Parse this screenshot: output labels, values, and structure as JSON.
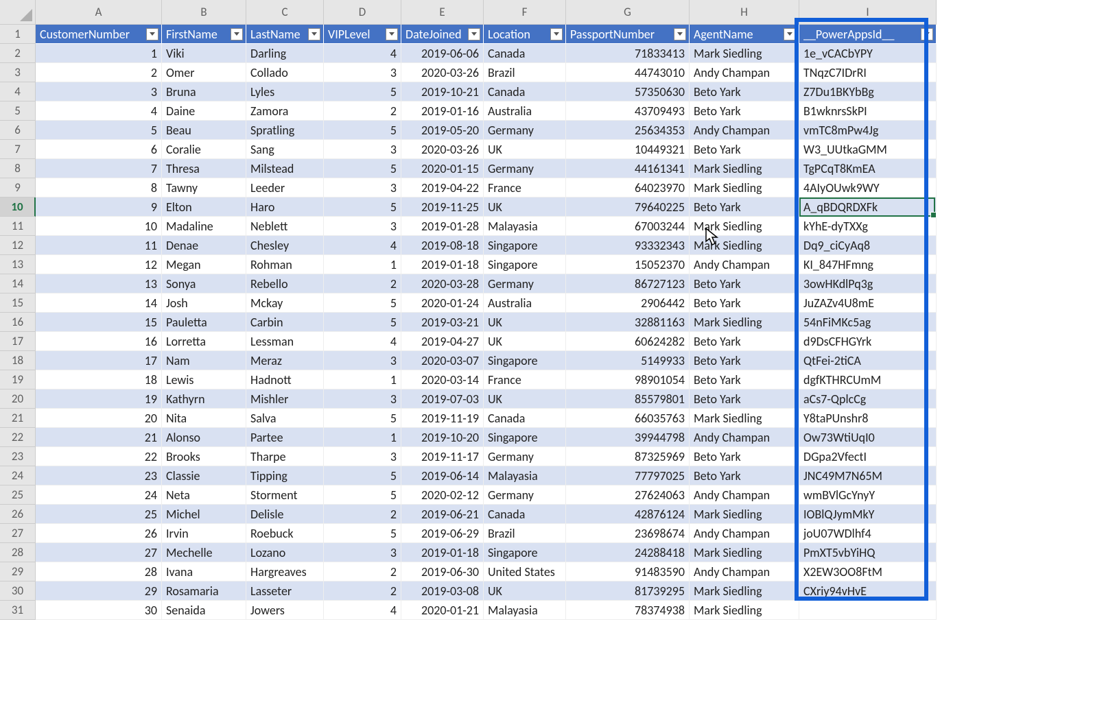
{
  "columns": {
    "letters": [
      "A",
      "B",
      "C",
      "D",
      "E",
      "F",
      "G",
      "H",
      "I"
    ],
    "headers": [
      "CustomerNumber",
      "FirstName",
      "LastName",
      "VIPLevel",
      "DateJoined",
      "Location",
      "PassportNumber",
      "AgentName",
      "__PowerAppsId__"
    ]
  },
  "selected_row_num": 10,
  "active_cell": {
    "row": 10,
    "col": 9
  },
  "rows": [
    {
      "n": 1,
      "first": "Viki",
      "last": "Darling",
      "vip": 4,
      "date": "2019-06-06",
      "loc": "Canada",
      "passport": 71833413,
      "agent": "Mark Siedling",
      "paid": "1e_vCACbYPY"
    },
    {
      "n": 2,
      "first": "Omer",
      "last": "Collado",
      "vip": 3,
      "date": "2020-03-26",
      "loc": "Brazil",
      "passport": 44743010,
      "agent": "Andy Champan",
      "paid": "TNqzC7IDrRI"
    },
    {
      "n": 3,
      "first": "Bruna",
      "last": "Lyles",
      "vip": 5,
      "date": "2019-10-21",
      "loc": "Canada",
      "passport": 57350630,
      "agent": "Beto Yark",
      "paid": "Z7Du1BKYbBg"
    },
    {
      "n": 4,
      "first": "Daine",
      "last": "Zamora",
      "vip": 2,
      "date": "2019-01-16",
      "loc": "Australia",
      "passport": 43709493,
      "agent": "Beto Yark",
      "paid": "B1wknrsSkPI"
    },
    {
      "n": 5,
      "first": "Beau",
      "last": "Spratling",
      "vip": 5,
      "date": "2019-05-20",
      "loc": "Germany",
      "passport": 25634353,
      "agent": "Andy Champan",
      "paid": "vmTC8mPw4Jg"
    },
    {
      "n": 6,
      "first": "Coralie",
      "last": "Sang",
      "vip": 3,
      "date": "2020-03-26",
      "loc": "UK",
      "passport": 10449321,
      "agent": "Beto Yark",
      "paid": "W3_UUtkaGMM"
    },
    {
      "n": 7,
      "first": "Thresa",
      "last": "Milstead",
      "vip": 5,
      "date": "2020-01-15",
      "loc": "Germany",
      "passport": 44161341,
      "agent": "Mark Siedling",
      "paid": "TgPCqT8KmEA"
    },
    {
      "n": 8,
      "first": "Tawny",
      "last": "Leeder",
      "vip": 3,
      "date": "2019-04-22",
      "loc": "France",
      "passport": 64023970,
      "agent": "Mark Siedling",
      "paid": "4AIyOUwk9WY"
    },
    {
      "n": 9,
      "first": "Elton",
      "last": "Haro",
      "vip": 5,
      "date": "2019-11-25",
      "loc": "UK",
      "passport": 79640225,
      "agent": "Beto Yark",
      "paid": "A_qBDQRDXFk"
    },
    {
      "n": 10,
      "first": "Madaline",
      "last": "Neblett",
      "vip": 3,
      "date": "2019-01-28",
      "loc": "Malayasia",
      "passport": 67003244,
      "agent": "Mark Siedling",
      "paid": "kYhE-dyTXXg"
    },
    {
      "n": 11,
      "first": "Denae",
      "last": "Chesley",
      "vip": 4,
      "date": "2019-08-18",
      "loc": "Singapore",
      "passport": 93332343,
      "agent": "Mark Siedling",
      "paid": "Dq9_ciCyAq8"
    },
    {
      "n": 12,
      "first": "Megan",
      "last": "Rohman",
      "vip": 1,
      "date": "2019-01-18",
      "loc": "Singapore",
      "passport": 15052370,
      "agent": "Andy Champan",
      "paid": "KI_847HFmng"
    },
    {
      "n": 13,
      "first": "Sonya",
      "last": "Rebello",
      "vip": 2,
      "date": "2020-03-28",
      "loc": "Germany",
      "passport": 86727123,
      "agent": "Beto Yark",
      "paid": "3owHKdlPq3g"
    },
    {
      "n": 14,
      "first": "Josh",
      "last": "Mckay",
      "vip": 5,
      "date": "2020-01-24",
      "loc": "Australia",
      "passport": 2906442,
      "agent": "Beto Yark",
      "paid": "JuZAZv4U8mE"
    },
    {
      "n": 15,
      "first": "Pauletta",
      "last": "Carbin",
      "vip": 5,
      "date": "2019-03-21",
      "loc": "UK",
      "passport": 32881163,
      "agent": "Mark Siedling",
      "paid": "54nFiMKc5ag"
    },
    {
      "n": 16,
      "first": "Lorretta",
      "last": "Lessman",
      "vip": 4,
      "date": "2019-04-27",
      "loc": "UK",
      "passport": 60624282,
      "agent": "Beto Yark",
      "paid": "d9DsCFHGYrk"
    },
    {
      "n": 17,
      "first": "Nam",
      "last": "Meraz",
      "vip": 3,
      "date": "2020-03-07",
      "loc": "Singapore",
      "passport": 5149933,
      "agent": "Beto Yark",
      "paid": "QtFei-2tiCA"
    },
    {
      "n": 18,
      "first": "Lewis",
      "last": "Hadnott",
      "vip": 1,
      "date": "2020-03-14",
      "loc": "France",
      "passport": 98901054,
      "agent": "Beto Yark",
      "paid": "dgfKTHRCUmM"
    },
    {
      "n": 19,
      "first": "Kathyrn",
      "last": "Mishler",
      "vip": 3,
      "date": "2019-07-03",
      "loc": "UK",
      "passport": 85579801,
      "agent": "Beto Yark",
      "paid": "aCs7-QplcCg"
    },
    {
      "n": 20,
      "first": "Nita",
      "last": "Salva",
      "vip": 5,
      "date": "2019-11-19",
      "loc": "Canada",
      "passport": 66035763,
      "agent": "Mark Siedling",
      "paid": "Y8taPUnshr8"
    },
    {
      "n": 21,
      "first": "Alonso",
      "last": "Partee",
      "vip": 1,
      "date": "2019-10-20",
      "loc": "Singapore",
      "passport": 39944798,
      "agent": "Andy Champan",
      "paid": "Ow73WtiUqI0"
    },
    {
      "n": 22,
      "first": "Brooks",
      "last": "Tharpe",
      "vip": 3,
      "date": "2019-11-17",
      "loc": "Germany",
      "passport": 87325969,
      "agent": "Beto Yark",
      "paid": "DGpa2VfectI"
    },
    {
      "n": 23,
      "first": "Classie",
      "last": "Tipping",
      "vip": 5,
      "date": "2019-06-14",
      "loc": "Malayasia",
      "passport": 77797025,
      "agent": "Beto Yark",
      "paid": "JNC49M7N65M"
    },
    {
      "n": 24,
      "first": "Neta",
      "last": "Storment",
      "vip": 5,
      "date": "2020-02-12",
      "loc": "Germany",
      "passport": 27624063,
      "agent": "Andy Champan",
      "paid": "wmBVlGcYnyY"
    },
    {
      "n": 25,
      "first": "Michel",
      "last": "Delisle",
      "vip": 2,
      "date": "2019-06-21",
      "loc": "Canada",
      "passport": 42876124,
      "agent": "Mark Siedling",
      "paid": "IOBlQJymMkY"
    },
    {
      "n": 26,
      "first": "Irvin",
      "last": "Roebuck",
      "vip": 5,
      "date": "2019-06-29",
      "loc": "Brazil",
      "passport": 23698674,
      "agent": "Andy Champan",
      "paid": "joU07WDlhf4"
    },
    {
      "n": 27,
      "first": "Mechelle",
      "last": "Lozano",
      "vip": 3,
      "date": "2019-01-18",
      "loc": "Singapore",
      "passport": 24288418,
      "agent": "Mark Siedling",
      "paid": "PmXT5vbYiHQ"
    },
    {
      "n": 28,
      "first": "Ivana",
      "last": "Hargreaves",
      "vip": 2,
      "date": "2019-06-30",
      "loc": "United States",
      "passport": 91483590,
      "agent": "Andy Champan",
      "paid": "X2EW3OO8FtM"
    },
    {
      "n": 29,
      "first": "Rosamaria",
      "last": "Lasseter",
      "vip": 2,
      "date": "2019-03-08",
      "loc": "UK",
      "passport": 81739295,
      "agent": "Mark Siedling",
      "paid": "CXriy94vHvE"
    },
    {
      "n": 30,
      "first": "Senaida",
      "last": "Jowers",
      "vip": 4,
      "date": "2020-01-21",
      "loc": "Malayasia",
      "passport": 78374938,
      "agent": "Mark Siedling",
      "paid": ""
    }
  ]
}
